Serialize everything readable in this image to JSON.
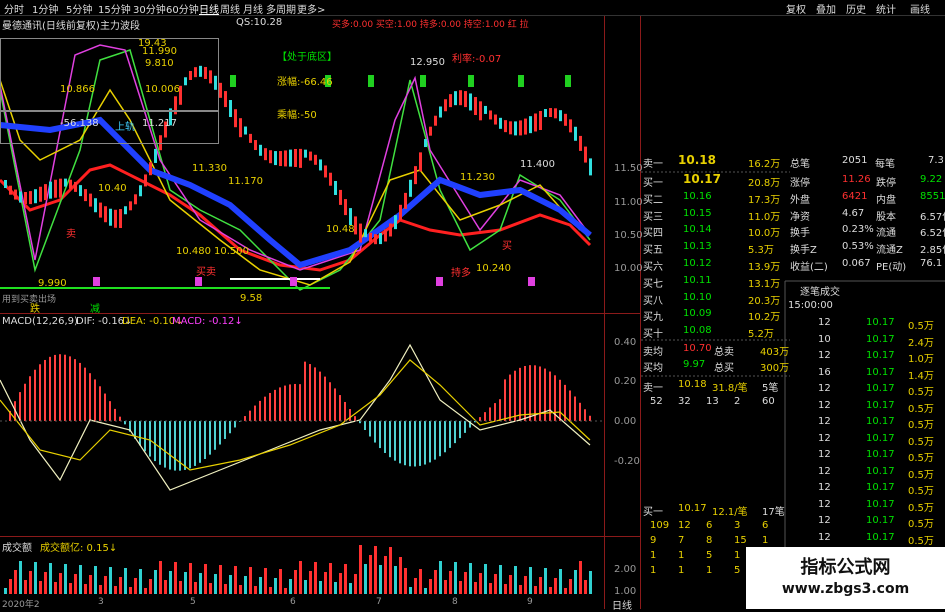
{
  "toolbar": {
    "left": [
      "分时",
      "1分钟",
      "5分钟",
      "15分钟",
      "30分钟",
      "60分钟",
      "日线",
      "周线",
      "月线",
      "多周期",
      "更多>"
    ],
    "right": [
      "复权",
      "叠加",
      "历史",
      "统计",
      "画线"
    ]
  },
  "main_chart": {
    "title": "曼德通讯(日线前复权)",
    "indicator": "主力波段",
    "qs_label": "QS:10.28",
    "buy_sell": "买多:0.00 买空:1.00 持多:0.00 持空:1.00 红 拉",
    "box_labels": [
      "10.866",
      "9.810",
      "10.006",
      "-56.138",
      "上轨",
      "11.217",
      "19.43",
      "11.990"
    ],
    "zone_title": "【处于底区】",
    "zone_lines": [
      "涨幅:-66.46",
      "乘幅:-50"
    ],
    "price_labels": [
      "12.950",
      "11.400",
      "11.330",
      "11.170",
      "11.230",
      "10.480",
      "10.500",
      "10.48",
      "10.240",
      "9.58",
      "9.990",
      "10.40"
    ],
    "misc_labels": [
      "利率:-0.07",
      "买卖",
      "持多",
      "买",
      "卖"
    ],
    "bottom_labels": [
      "用到买卖出场",
      "跌",
      "减"
    ],
    "yaxis": [
      "11.50",
      "11.00",
      "10.50",
      "10.00"
    ]
  },
  "macd": {
    "title": "MACD(12,26,9)",
    "dif": "DIF: -0.16↓",
    "dea": "DEA: -0.10↓",
    "macd": "MACD: -0.12↓",
    "yaxis": [
      "0.40",
      "0.20",
      "0.00",
      "-0.20"
    ]
  },
  "volume": {
    "title": "成交额",
    "sub": "成交额亿: 0.15↓",
    "yaxis": [
      "2.00",
      "1.00"
    ],
    "xaxis": [
      "2020年2",
      "3",
      "5",
      "6",
      "7",
      "8",
      "9"
    ],
    "period": "日线"
  },
  "quote": {
    "top": [
      [
        "买率",
        "10.19",
        "24.5万",
        "卖数",
        "10.24",
        "总额",
        "152.5"
      ]
    ],
    "sell1": {
      "label": "卖一",
      "price": "10.18",
      "vol": "16.2万",
      "k1": "总笔",
      "v1": "2051",
      "k2": "每笔",
      "v2": "7.3"
    },
    "levels": [
      {
        "label": "买一",
        "price": "10.17",
        "vol": "20.8万"
      },
      {
        "label": "买二",
        "price": "10.16",
        "vol": "17.3万"
      },
      {
        "label": "买三",
        "price": "10.15",
        "vol": "11.0万"
      },
      {
        "label": "买四",
        "price": "10.14",
        "vol": "10.0万"
      },
      {
        "label": "买五",
        "price": "10.13",
        "vol": "5.3万"
      },
      {
        "label": "买六",
        "price": "10.12",
        "vol": "13.9万"
      },
      {
        "label": "买七",
        "price": "10.11",
        "vol": "13.1万"
      },
      {
        "label": "买八",
        "price": "10.10",
        "vol": "20.3万"
      },
      {
        "label": "买九",
        "price": "10.09",
        "vol": "10.2万"
      },
      {
        "label": "买十",
        "price": "10.08",
        "vol": "5.2万"
      }
    ],
    "stats": [
      {
        "k1": "涨停",
        "v1": "11.26",
        "k2": "跌停",
        "v2": "9.22"
      },
      {
        "k1": "外盘",
        "v1": "6421",
        "k2": "内盘",
        "v2": "8551"
      },
      {
        "k1": "净资",
        "v1": "4.67",
        "k2": "股本",
        "v2": "6.57亿"
      },
      {
        "k1": "换手",
        "v1": "0.23%",
        "k2": "流通",
        "v2": "6.52亿"
      },
      {
        "k1": "换手Z",
        "v1": "0.53%",
        "k2": "流通Z",
        "v2": "2.85亿"
      },
      {
        "k1": "收益(二)",
        "v1": "0.067",
        "k2": "PE(动)",
        "v2": "76.1"
      }
    ],
    "avg": [
      {
        "label": "卖均",
        "price": "10.70",
        "k": "总卖",
        "v": "403万"
      },
      {
        "label": "买均",
        "price": "9.97",
        "k": "总买",
        "v": "300万"
      }
    ],
    "sell_row": {
      "label": "卖一",
      "price": "10.18",
      "vol": "31.8/笔",
      "cnt": "5笔"
    },
    "sell_nums": [
      "52",
      "32",
      "13",
      "2",
      "60"
    ],
    "buy_row": {
      "label": "买一",
      "price": "10.17",
      "vol": "12.1/笔",
      "cnt": "17笔"
    },
    "buy_nums": [
      [
        "109",
        "12",
        "6",
        "3",
        "6"
      ],
      [
        "9",
        "7",
        "8",
        "15",
        "1"
      ],
      [
        "1",
        "1",
        "5",
        "1",
        "1"
      ],
      [
        "1",
        "1",
        "1",
        "5",
        "2"
      ]
    ]
  },
  "ticks": {
    "title": "逐笔成交",
    "time": "15:00:00",
    "rows": [
      [
        "12",
        "10.17",
        "0.5万",
        "10.17",
        "0.5万"
      ],
      [
        "10",
        "10.17",
        "2.4万",
        "10.17",
        "0.5万"
      ],
      [
        "12",
        "10.17",
        "1.0万",
        "10.17",
        "0.5万"
      ],
      [
        "16",
        "10.17",
        "1.4万",
        "10.17",
        "0.5万"
      ],
      [
        "12",
        "10.17",
        "0.5万",
        "10.17",
        "0.5万"
      ],
      [
        "12",
        "10.17",
        "0.5万",
        "10.17",
        "0.5万"
      ],
      [
        "12",
        "10.17",
        "0.5万",
        "10.17",
        "0.5万"
      ],
      [
        "12",
        "10.17",
        "0.5万",
        "10.17",
        "0.5万"
      ],
      [
        "12",
        "10.17",
        "0.5万",
        "10.17",
        "0.5万"
      ],
      [
        "12",
        "10.17",
        "0.5万",
        "10.17",
        "0.5万"
      ],
      [
        "12",
        "10.17",
        "0.5万",
        "10.17",
        "0.5万"
      ],
      [
        "12",
        "10.17",
        "0.5万",
        "10.17",
        "0.5万"
      ],
      [
        "12",
        "10.17",
        "0.5万",
        "10.17",
        "0.5万"
      ],
      [
        "12",
        "10.17",
        "0.5万",
        "10.17",
        "0.5万"
      ],
      [
        "12",
        "10.17",
        "0.5万",
        "10.17",
        "0.5万"
      ],
      [
        "12",
        "10.17",
        "0.5万",
        "10.17",
        "0.5万"
      ]
    ]
  },
  "watermark": {
    "line1": "指标公式网",
    "line2": "www.zbgs3.com"
  }
}
